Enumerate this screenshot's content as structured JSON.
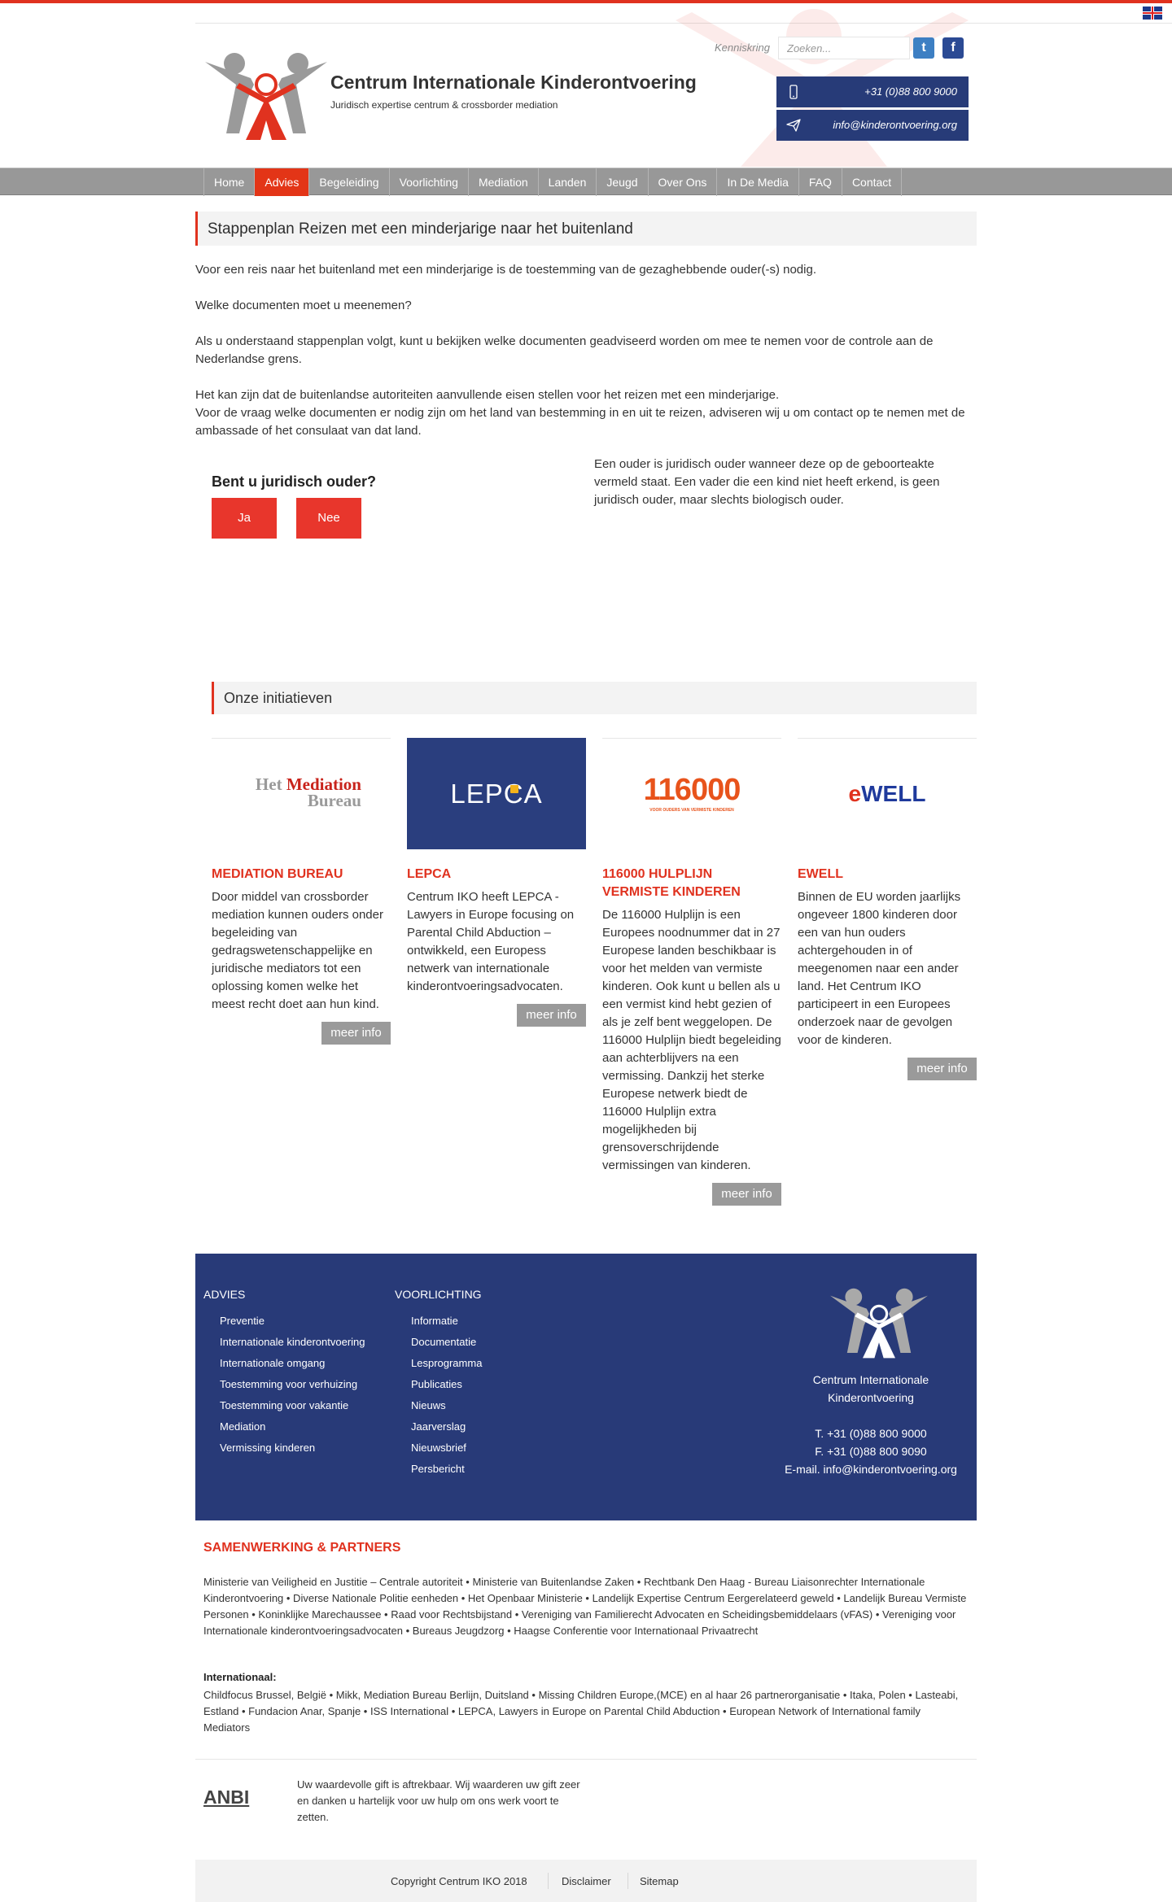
{
  "brand": {
    "title": "Centrum Internationale Kinderontvoering",
    "subtitle": "Juridisch expertise centrum & crossborder mediation",
    "accent": "#e0321f",
    "navy": "#283a78"
  },
  "header": {
    "kenniskring": "Kenniskring",
    "search_placeholder": "Zoeken...",
    "phone": "+31 (0)88 800 9000",
    "email": "info@kinderontvoering.org",
    "twitter": "t",
    "facebook": "f"
  },
  "nav": {
    "items": [
      "Home",
      "Advies",
      "Begeleiding",
      "Voorlichting",
      "Mediation",
      "Landen",
      "Jeugd",
      "Over Ons",
      "In De Media",
      "FAQ",
      "Contact"
    ],
    "active": "Advies"
  },
  "page": {
    "title": "Stappenplan Reizen met een minderjarige naar het buitenland",
    "p1": "Voor een reis naar het buitenland met een minderjarige is de toestemming van de gezaghebbende ouder(-s) nodig.",
    "p2": "Welke documenten moet u meenemen?",
    "p3": "Als u onderstaand stappenplan volgt, kunt u bekijken welke documenten geadviseerd worden om mee te nemen voor de controle aan de Nederlandse grens.",
    "p4a": "Het kan zijn dat de buitenlandse autoriteiten aanvullende eisen stellen voor het reizen met een minderjarige.",
    "p4b": "Voor de vraag welke documenten er nodig zijn om het land van bestemming in en uit te reizen, adviseren wij u om contact op te nemen met de ambassade of het consulaat van dat land."
  },
  "question": {
    "title": "Bent u juridisch ouder?",
    "yes": "Ja",
    "no": "Nee",
    "note": "Een ouder is juridisch ouder wanneer deze op de geboorteakte vermeld staat. Een vader die een kind niet heeft erkend, is geen juridisch ouder, maar slechts biologisch ouder."
  },
  "initiatives": {
    "title": "Onze initiatieven",
    "more_label": "meer info",
    "cards": [
      {
        "logo_a": "Het ",
        "logo_b": "Mediation",
        "logo_c": "Bureau",
        "title": "Mediation Bureau",
        "text": "Door middel van crossborder mediation kunnen ouders onder begeleiding van gedragswetenschappelijke en juridische mediators tot een oplossing komen welke het meest recht doet aan hun kind."
      },
      {
        "logo_a": "LEPCA",
        "title": "LEPCA",
        "text": "Centrum IKO heeft LEPCA - Lawyers in Europe focusing on Parental Child Abduction – ontwikkeld, een Europess netwerk van internationale kinderontvoeringsadvocaten."
      },
      {
        "logo_a": "116000",
        "logo_b": "VOOR OUDERS VAN VERMISTE KINDEREN",
        "title": "116000 Hulplijn vermiste kinderen",
        "text": "De 116000 Hulplijn is een Europees noodnummer dat in 27 Europese landen beschikbaar is voor het melden van vermiste kinderen. Ook kunt u bellen als u een vermist kind hebt gezien of als je zelf bent weggelopen. De 116000 Hulplijn biedt begeleiding aan achterblijvers na een vermissing. Dankzij het sterke Europese netwerk biedt de 116000 Hulplijn extra mogelijkheden bij grensoverschrijdende vermissingen van kinderen."
      },
      {
        "logo_a": "e",
        "logo_b": "WELL",
        "title": "Ewell",
        "text": "Binnen de EU worden jaarlijks ongeveer 1800 kinderen door een van hun ouders achtergehouden in of meegenomen naar een ander land. Het Centrum IKO participeert in een Europees onderzoek naar de gevolgen voor de kinderen."
      }
    ]
  },
  "footer": {
    "col1_title": "Advies",
    "col1": [
      "Preventie",
      "Internationale kinderontvoering",
      "Internationale omgang",
      "Toestemming voor verhuizing",
      "Toestemming voor vakantie",
      "Mediation",
      "Vermissing kinderen"
    ],
    "col2_title": "Voorlichting",
    "col2": [
      "Informatie",
      "Documentatie",
      "Lesprogramma",
      "Publicaties",
      "Nieuws",
      "Jaarverslag",
      "Nieuwsbrief",
      "Persbericht"
    ],
    "name_line1": "Centrum Internationale",
    "name_line2": "Kinderontvoering",
    "phone": "T. +31 (0)88 800 9000",
    "fax": "F. +31 (0)88 800 9090",
    "email": "E-mail. info@kinderontvoering.org"
  },
  "partners": {
    "title": "SAMENWERKING & PARTNERS",
    "national": "Ministerie van Veiligheid en Justitie – Centrale autoriteit • Ministerie van Buitenlandse Zaken • Rechtbank Den Haag - Bureau Liaisonrechter Internationale Kinderontvoering • Diverse Nationale Politie eenheden • Het Openbaar Ministerie • Landelijk Expertise Centrum Eergerelateerd geweld • Landelijk Bureau Vermiste Personen • Koninklijke Marechaussee • Raad voor Rechtsbijstand • Vereniging van Familierecht Advocaten en Scheidingsbemiddelaars (vFAS) • Vereniging voor Internationale kinderontvoeringsadvocaten • Bureaus Jeugdzorg • Haagse Conferentie voor Internationaal Privaatrecht",
    "intl_title": "Internationaal:",
    "international": "Childfocus Brussel, België • Mikk, Mediation Bureau Berlijn, Duitsland • Missing Children Europe,(MCE) en al haar 26 partnerorganisatie • Itaka, Polen • Lasteabi, Estland • Fundacion Anar, Spanje • ISS International • LEPCA, Lawyers in Europe on Parental Child Abduction • European Network of International family Mediators"
  },
  "anbi": {
    "label": "ANBI",
    "text": "Uw waardevolle gift is aftrekbaar. Wij waarderen uw gift zeer en danken u hartelijk voor uw hulp om ons werk voort te zetten."
  },
  "bottom": {
    "copyright": "Copyright Centrum IKO 2018",
    "disclaimer": "Disclaimer",
    "sitemap": "Sitemap"
  }
}
